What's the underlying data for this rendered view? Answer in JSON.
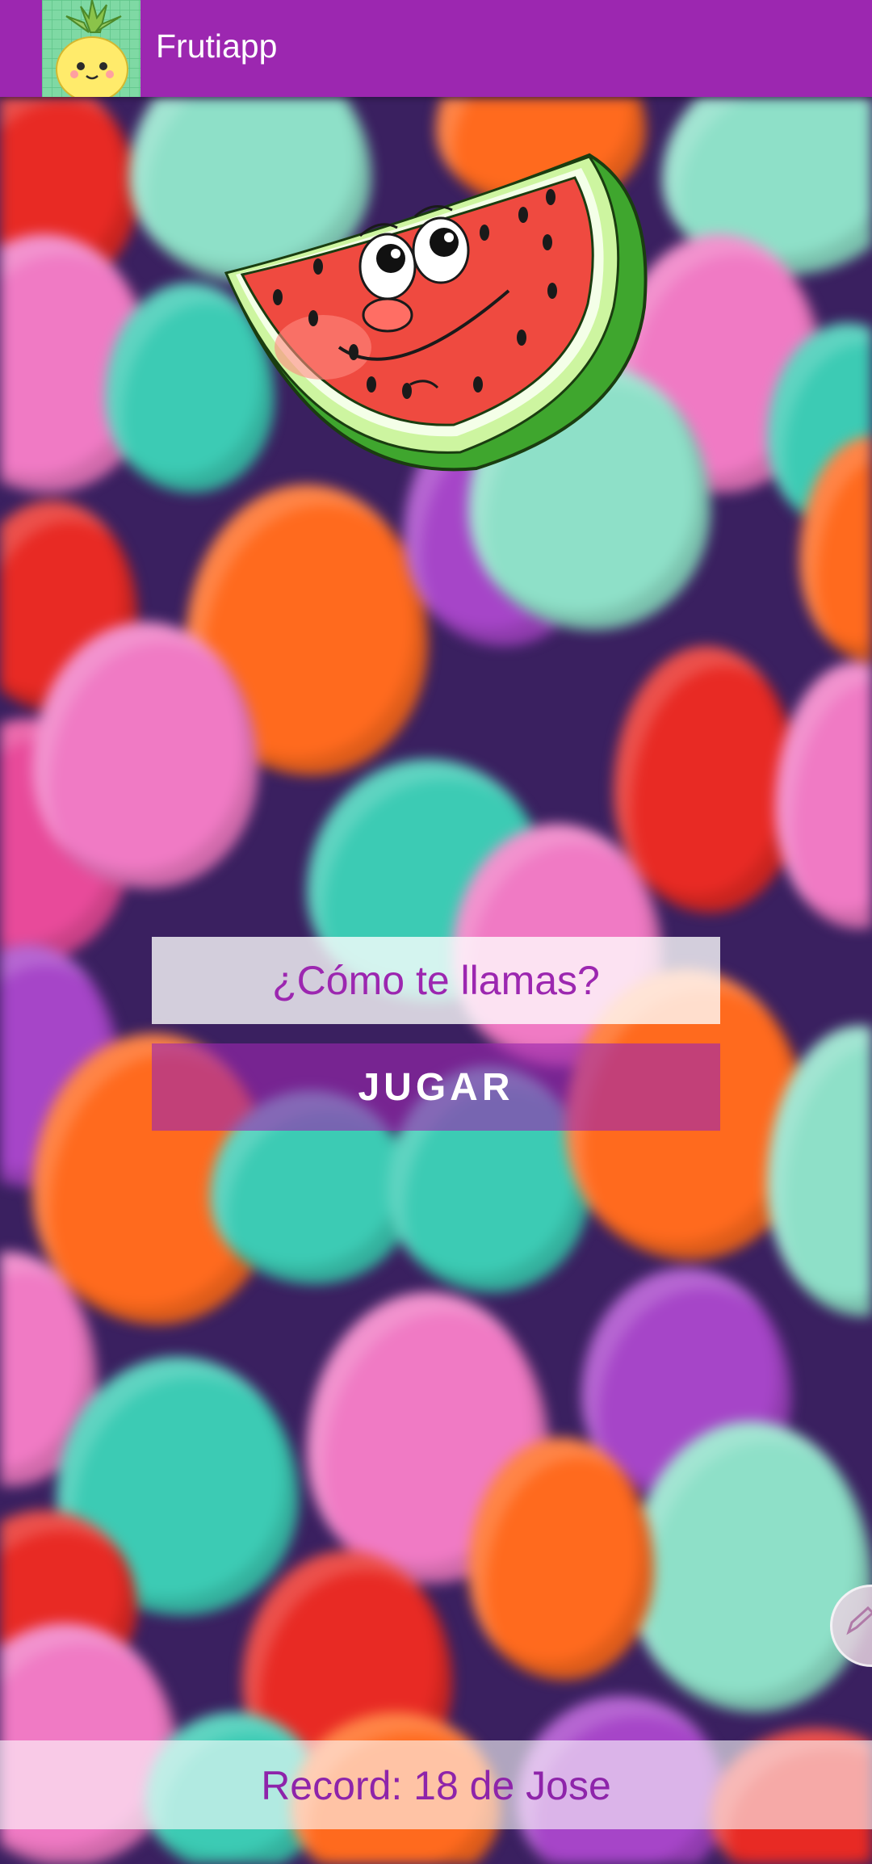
{
  "app": {
    "title": "Frutiapp",
    "logo_icon": "pineapple-icon",
    "bar_color": "#9c27b0"
  },
  "hero": {
    "icon": "smiling-watermelon-icon"
  },
  "form": {
    "name_placeholder": "¿Cómo te llamas?",
    "play_label": "JUGAR"
  },
  "record": {
    "text": "Record: 18 de Jose"
  },
  "floating": {
    "icon": "pencil-icon"
  },
  "background": {
    "icon": "balloons-pattern",
    "colors": [
      "#e84a9a",
      "#f07ac4",
      "#3ccbb4",
      "#8ee0c8",
      "#ff6a1e",
      "#e82a24",
      "#a645c8",
      "#7a3aa0"
    ]
  }
}
